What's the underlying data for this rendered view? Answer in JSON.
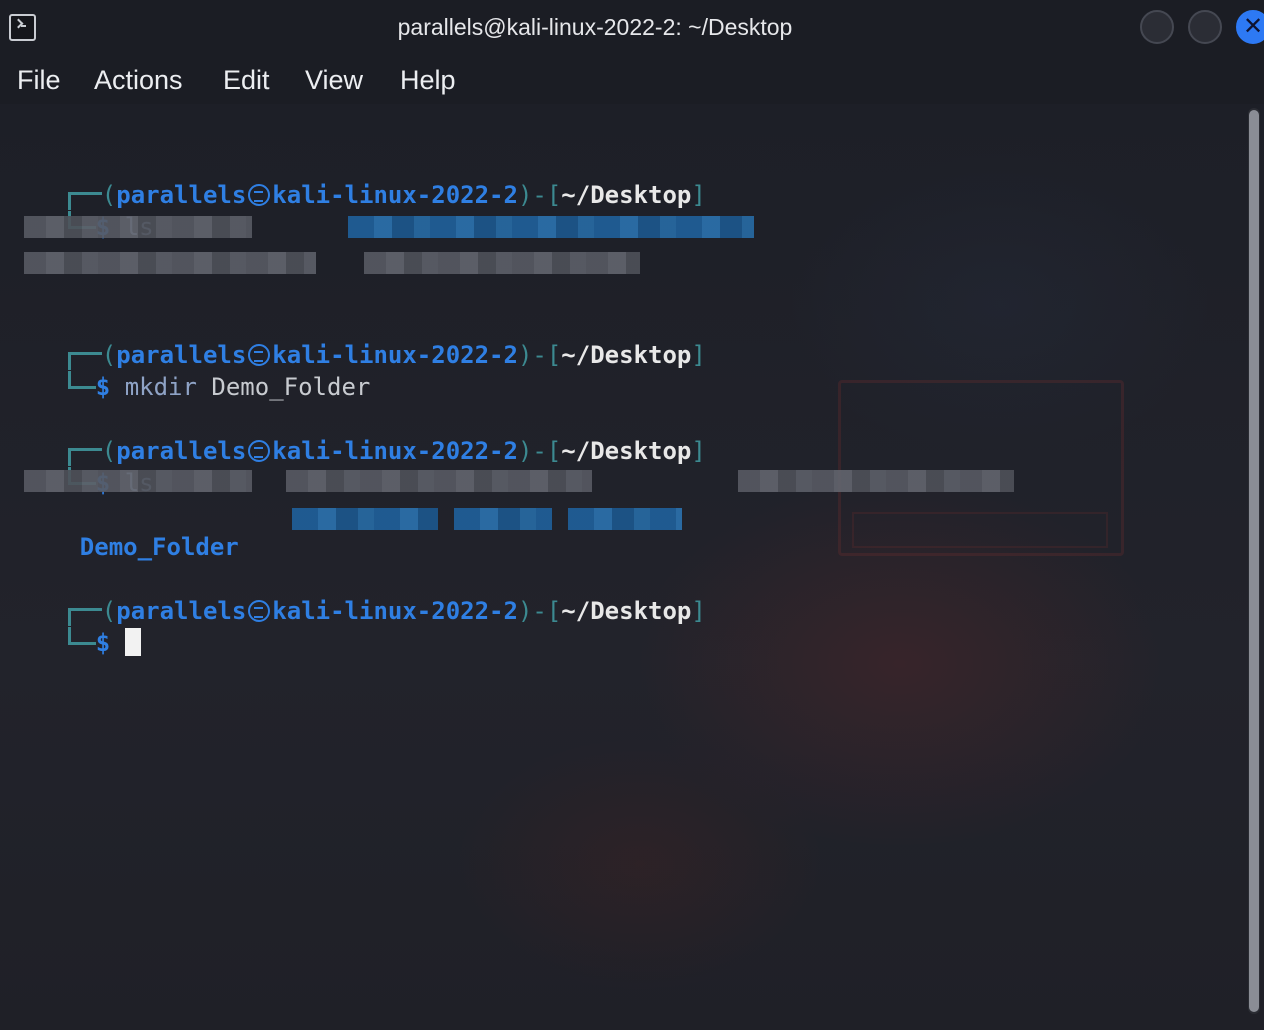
{
  "window": {
    "title": "parallels@kali-linux-2022-2: ~/Desktop"
  },
  "menu": {
    "file": "File",
    "actions": "Actions",
    "edit": "Edit",
    "view": "View",
    "help": "Help"
  },
  "prompt": {
    "open": "(",
    "user": "parallels",
    "host": "kali-linux-2022-2",
    "mid": ")-[",
    "path": "~/Desktop",
    "close": "]",
    "dollar": "$"
  },
  "commands": {
    "c1": "ls",
    "c2_kw": "mkdir",
    "c2_arg": "Demo_Folder",
    "c3": "ls"
  },
  "output": {
    "folder": "Demo_Folder"
  },
  "icons": {
    "terminal": "terminal-icon",
    "kali": "kali-skull-icon"
  },
  "colors": {
    "prompt_blue": "#2f7fe3",
    "bracket_teal": "#3c8a91",
    "close_button": "#2d79f4",
    "background": "#1f2129"
  }
}
